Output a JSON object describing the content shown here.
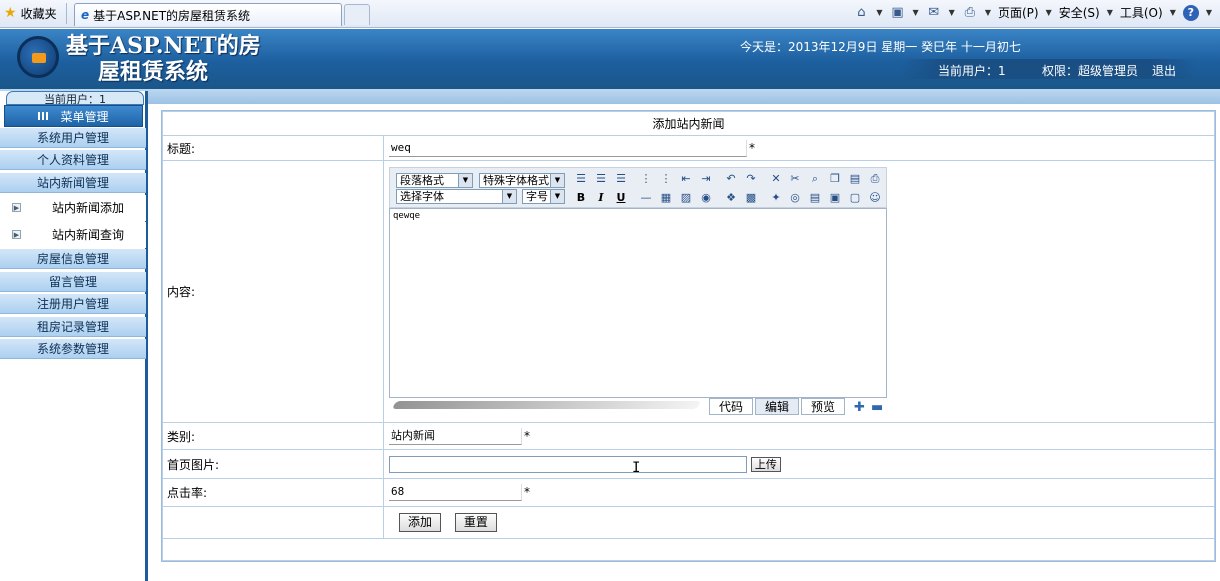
{
  "browser": {
    "favorites": "收藏夹",
    "tab_title": "基于ASP.NET的房屋租赁系统",
    "menus": {
      "page": "页面(P)",
      "safety": "安全(S)",
      "tools": "工具(O)"
    }
  },
  "header": {
    "title_line1": "基于ASP.NET的房",
    "title_line2": "屋租赁系统",
    "date": "今天是：2013年12月9日  星期一  癸巳年  十一月初七",
    "current_user": "当前用户：1",
    "permission": "权限：超级管理员",
    "logout": "退出"
  },
  "sidebar": {
    "current_user_partial": "当前用户：1",
    "menu_title": "菜单管理",
    "items": [
      {
        "label": "系统用户管理"
      },
      {
        "label": "个人资料管理"
      },
      {
        "label": "站内新闻管理"
      },
      {
        "label": "站内新闻添加",
        "sub": true
      },
      {
        "label": "站内新闻查询",
        "sub": true
      },
      {
        "label": "房屋信息管理"
      },
      {
        "label": "留言管理"
      },
      {
        "label": "注册用户管理"
      },
      {
        "label": "租房记录管理"
      },
      {
        "label": "系统参数管理"
      }
    ]
  },
  "form": {
    "heading": "添加站内新闻",
    "title_label": "标题:",
    "title_value": "weq",
    "content_label": "内容:",
    "content_value": "qewqe",
    "category_label": "类别:",
    "category_value": "站内新闻",
    "image_label": "首页图片:",
    "image_value": "",
    "upload_button": "上传",
    "clicks_label": "点击率:",
    "clicks_value": "68",
    "required_mark": "*",
    "add_button": "添加",
    "reset_button": "重置"
  },
  "editor": {
    "paragraph_format": "段落格式",
    "special_format": "特殊字体格式",
    "font_select": "选择字体",
    "font_size": "字号",
    "bold": "B",
    "italic": "I",
    "underline": "U",
    "tabs": [
      "代码",
      "编辑",
      "预览"
    ]
  }
}
